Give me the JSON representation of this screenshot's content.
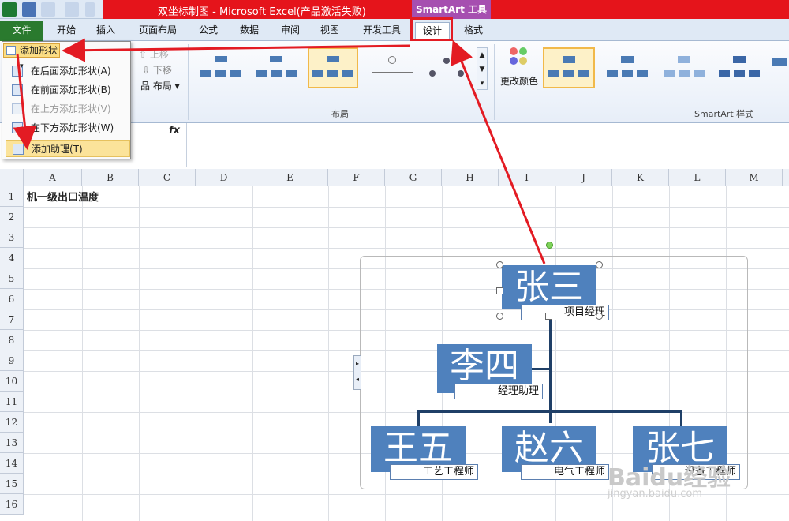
{
  "title": "双坐标制图 - Microsoft Excel(产品激活失败)",
  "contextual_tab": "SmartArt 工具",
  "tabs": [
    "文件",
    "开始",
    "插入",
    "页面布局",
    "公式",
    "数据",
    "审阅",
    "视图",
    "开发工具",
    "设计",
    "格式"
  ],
  "ribbon": {
    "add_shape": "添加形状",
    "move_up": "上移",
    "move_down": "下移",
    "layout_btn": "布局",
    "group_layout": "布局",
    "change_colors": "更改颜色",
    "group_styles": "SmartArt 样式"
  },
  "menu": [
    {
      "label": "在后面添加形状(A)",
      "disabled": false
    },
    {
      "label": "在前面添加形状(B)",
      "disabled": false
    },
    {
      "label": "在上方添加形状(V)",
      "disabled": true
    },
    {
      "label": "在下方添加形状(W)",
      "disabled": false
    },
    {
      "label": "添加助理(T)",
      "disabled": false,
      "active": true
    }
  ],
  "formula": {
    "fx": "fx"
  },
  "columns": [
    "A",
    "B",
    "C",
    "D",
    "E",
    "F",
    "G",
    "H",
    "I",
    "J",
    "K",
    "L",
    "M"
  ],
  "rows": [
    "1",
    "2",
    "3",
    "4",
    "5",
    "6",
    "7",
    "8",
    "9",
    "10",
    "11",
    "12",
    "13",
    "14",
    "15",
    "16"
  ],
  "cell_a1": "机一级出口温度",
  "org": {
    "top": {
      "name": "张三",
      "role": "项目经理"
    },
    "assistant": {
      "name": "李四",
      "role": "经理助理"
    },
    "children": [
      {
        "name": "王五",
        "role": "工艺工程师"
      },
      {
        "name": "赵六",
        "role": "电气工程师"
      },
      {
        "name": "张七",
        "role": "设备工程师"
      }
    ]
  },
  "watermark": "Baidu经验",
  "watermark_url": "jingyan.baidu.com",
  "colors": {
    "title_bar": "#e5141b",
    "accent": "#4f81bd",
    "arrow": "#e31b23",
    "file_tab": "#2a7a2e",
    "contextual": "#a64fb0"
  }
}
